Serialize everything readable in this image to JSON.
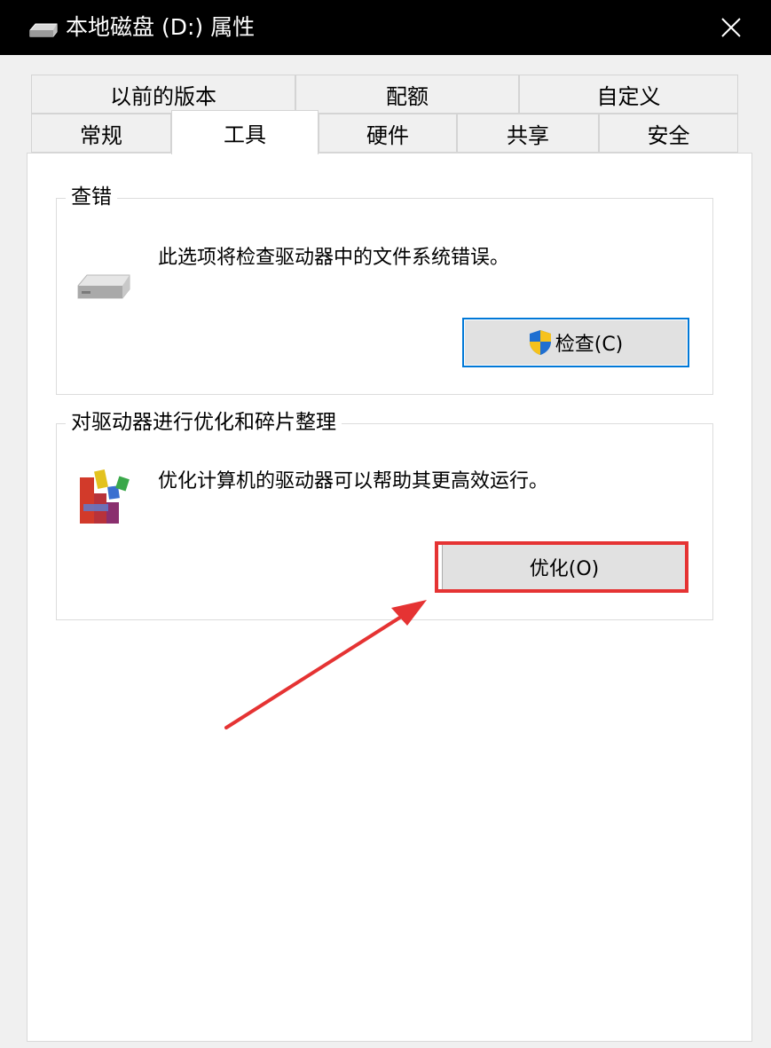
{
  "window": {
    "title": "本地磁盘 (D:) 属性",
    "close_icon": "close-icon"
  },
  "tabs": {
    "row1": [
      {
        "label": "以前的版本"
      },
      {
        "label": "配额"
      },
      {
        "label": "自定义"
      }
    ],
    "row2": [
      {
        "label": "常规"
      },
      {
        "label": "工具",
        "active": true
      },
      {
        "label": "硬件"
      },
      {
        "label": "共享"
      },
      {
        "label": "安全"
      }
    ]
  },
  "error_checking": {
    "title": "查错",
    "description": "此选项将检查驱动器中的文件系统错误。",
    "button_label": "检查(C)",
    "icon": "drive-icon",
    "button_icon": "uac-shield-icon"
  },
  "optimize": {
    "title": "对驱动器进行优化和碎片整理",
    "description": "优化计算机的驱动器可以帮助其更高效运行。",
    "button_label": "优化(O)",
    "icon": "defrag-icon"
  },
  "annotation": {
    "color": "#e53333",
    "arrow_icon": "annotation-arrow"
  },
  "colors": {
    "accent_border": "#0078d7",
    "titlebar": "#000000"
  }
}
